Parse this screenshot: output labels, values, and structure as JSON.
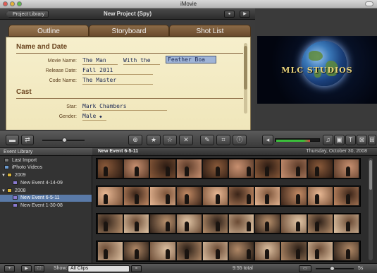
{
  "window": {
    "title": "iMovie"
  },
  "project": {
    "library_button": "Project Library",
    "title": "New Project (Spy)"
  },
  "tabs": [
    "Outline",
    "Storyboard",
    "Shot List"
  ],
  "outline": {
    "section1": "Name and Date",
    "movie_name_label": "Movie Name:",
    "movie_name_parts": [
      "The Man",
      "With the",
      "Feather Boa"
    ],
    "release_date_label": "Release Date:",
    "release_date": "Fall 2011",
    "code_name_label": "Code Name:",
    "code_name": "The Master",
    "section2": "Cast",
    "star_label": "Star:",
    "star": "Mark Chambers",
    "gender_label": "Gender:",
    "gender": "Male"
  },
  "viewer": {
    "text": "MLC STUDIOS"
  },
  "audio_meter_level": 0.78,
  "event_library": {
    "header": "Event Library",
    "items": [
      {
        "label": "Last Import",
        "kind": "import"
      },
      {
        "label": "iPhoto Videos",
        "kind": "iphoto"
      },
      {
        "label": "2009",
        "kind": "year"
      },
      {
        "label": "New Event 4-14-09",
        "kind": "event"
      },
      {
        "label": "2008",
        "kind": "year"
      },
      {
        "label": "New Event 6-5-11",
        "kind": "event",
        "selected": true
      },
      {
        "label": "New Event 1-30-08",
        "kind": "event"
      }
    ]
  },
  "event_browser": {
    "event_name": "New Event 6-5-11",
    "date": "Thursday, October 30, 2008"
  },
  "bottom": {
    "show_label": "Show:",
    "show_value": "All Clips",
    "total": "9:55 total",
    "duration": "5s"
  },
  "colors": {
    "selection": "#5a7aa8",
    "tab": "#8a6a47",
    "paper": "#f6efcc"
  }
}
